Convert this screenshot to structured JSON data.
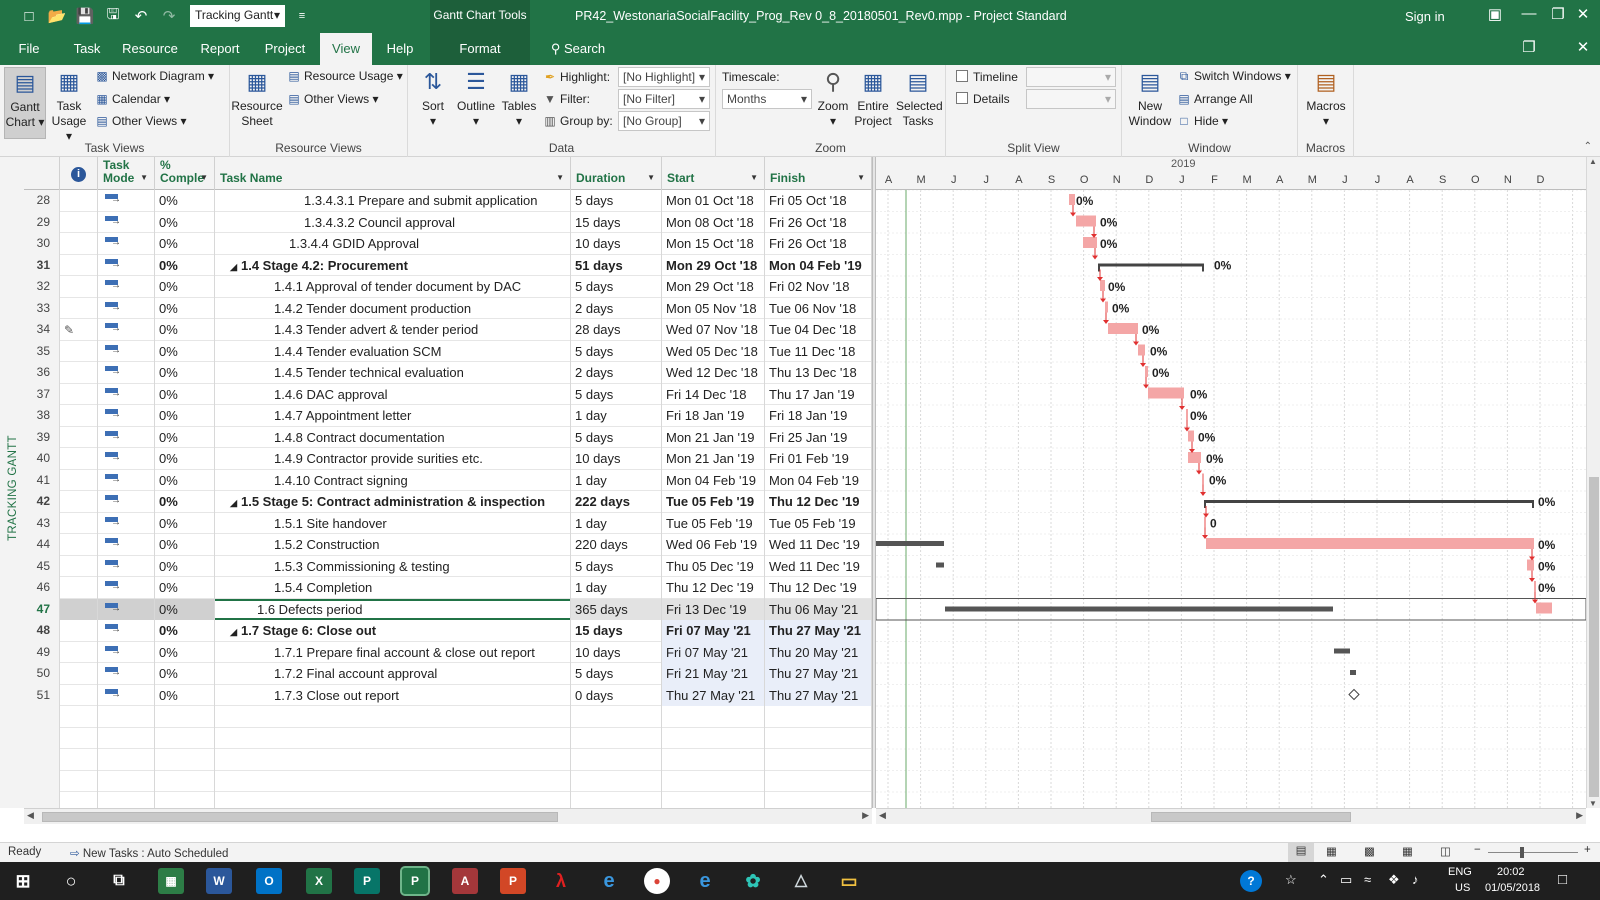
{
  "titlebar": {
    "view_selector": "Tracking Gantt",
    "context_tool": "Gantt Chart Tools",
    "document_title": "PR42_WestonariaSocialFacility_Prog_Rev 0_8_20180501_Rev0.mpp  -  Project Standard",
    "signin": "Sign in"
  },
  "tabs": [
    "File",
    "Task",
    "Resource",
    "Report",
    "Project",
    "View",
    "Help",
    "Format"
  ],
  "search_label": "Search",
  "ribbon": {
    "task_views": {
      "label": "Task Views",
      "gantt_chart": "Gantt Chart",
      "task_usage": "Task Usage",
      "network_diagram": "Network Diagram",
      "calendar": "Calendar",
      "other_views": "Other Views"
    },
    "resource_views": {
      "label": "Resource Views",
      "resource_sheet": "Resource Sheet",
      "resource_usage": "Resource Usage",
      "other_views": "Other Views"
    },
    "data": {
      "label": "Data",
      "sort": "Sort",
      "outline": "Outline",
      "tables": "Tables",
      "highlight_label": "Highlight:",
      "highlight_value": "[No Highlight]",
      "filter_label": "Filter:",
      "filter_value": "[No Filter]",
      "groupby_label": "Group by:",
      "groupby_value": "[No Group]"
    },
    "zoom": {
      "label": "Zoom",
      "timescale_label": "Timescale:",
      "timescale_value": "Months",
      "zoom": "Zoom",
      "entire_project": "Entire Project",
      "selected_tasks": "Selected Tasks"
    },
    "split_view": {
      "label": "Split View",
      "timeline": "Timeline",
      "details": "Details"
    },
    "window": {
      "label": "Window",
      "new_window": "New Window",
      "switch_windows": "Switch Windows",
      "arrange_all": "Arrange All",
      "hide": "Hide"
    },
    "macros": {
      "label": "Macros",
      "macros": "Macros"
    }
  },
  "side_label": "TRACKING GANTT",
  "columns": {
    "mode": "Task Mode",
    "pct": "% Comple",
    "name": "Task Name",
    "duration": "Duration",
    "start": "Start",
    "finish": "Finish"
  },
  "tasks": [
    {
      "id": "28",
      "pct": "0%",
      "name": "1.3.4.3.1 Prepare and submit application",
      "dur": "5 days",
      "start": "Mon 01 Oct '18",
      "fin": "Fri 05 Oct '18"
    },
    {
      "id": "29",
      "pct": "0%",
      "name": "1.3.4.3.2 Council approval",
      "dur": "15 days",
      "start": "Mon 08 Oct '18",
      "fin": "Fri 26 Oct '18"
    },
    {
      "id": "30",
      "pct": "0%",
      "name": "1.3.4.4 GDID Approval",
      "dur": "10 days",
      "start": "Mon 15 Oct '18",
      "fin": "Fri 26 Oct '18"
    },
    {
      "id": "31",
      "pct": "0%",
      "name": "1.4 Stage 4.2: Procurement",
      "dur": "51 days",
      "start": "Mon 29 Oct '18",
      "fin": "Mon 04 Feb '19"
    },
    {
      "id": "32",
      "pct": "0%",
      "name": "1.4.1 Approval of tender document by DAC",
      "dur": "5 days",
      "start": "Mon 29 Oct '18",
      "fin": "Fri 02 Nov '18"
    },
    {
      "id": "33",
      "pct": "0%",
      "name": "1.4.2 Tender document production",
      "dur": "2 days",
      "start": "Mon 05 Nov '18",
      "fin": "Tue 06 Nov '18"
    },
    {
      "id": "34",
      "pct": "0%",
      "name": "1.4.3 Tender advert & tender period",
      "dur": "28 days",
      "start": "Wed 07 Nov '18",
      "fin": "Tue 04 Dec '18"
    },
    {
      "id": "35",
      "pct": "0%",
      "name": "1.4.4 Tender evaluation SCM",
      "dur": "5 days",
      "start": "Wed 05 Dec '18",
      "fin": "Tue 11 Dec '18"
    },
    {
      "id": "36",
      "pct": "0%",
      "name": "1.4.5 Tender technical evaluation",
      "dur": "2 days",
      "start": "Wed 12 Dec '18",
      "fin": "Thu 13 Dec '18"
    },
    {
      "id": "37",
      "pct": "0%",
      "name": "1.4.6 DAC approval",
      "dur": "5 days",
      "start": "Fri 14 Dec '18",
      "fin": "Thu 17 Jan '19"
    },
    {
      "id": "38",
      "pct": "0%",
      "name": "1.4.7 Appointment letter",
      "dur": "1 day",
      "start": "Fri 18 Jan '19",
      "fin": "Fri 18 Jan '19"
    },
    {
      "id": "39",
      "pct": "0%",
      "name": "1.4.8 Contract documentation",
      "dur": "5 days",
      "start": "Mon 21 Jan '19",
      "fin": "Fri 25 Jan '19"
    },
    {
      "id": "40",
      "pct": "0%",
      "name": "1.4.9 Contractor provide surities etc.",
      "dur": "10 days",
      "start": "Mon 21 Jan '19",
      "fin": "Fri 01 Feb '19"
    },
    {
      "id": "41",
      "pct": "0%",
      "name": "1.4.10 Contract signing",
      "dur": "1 day",
      "start": "Mon 04 Feb '19",
      "fin": "Mon 04 Feb '19"
    },
    {
      "id": "42",
      "pct": "0%",
      "name": "1.5 Stage 5: Contract administration & inspection",
      "dur": "222 days",
      "start": "Tue 05 Feb '19",
      "fin": "Thu 12 Dec '19"
    },
    {
      "id": "43",
      "pct": "0%",
      "name": "1.5.1 Site handover",
      "dur": "1 day",
      "start": "Tue 05 Feb '19",
      "fin": "Tue 05 Feb '19"
    },
    {
      "id": "44",
      "pct": "0%",
      "name": "1.5.2 Construction",
      "dur": "220 days",
      "start": "Wed 06 Feb '19",
      "fin": "Wed 11 Dec '19"
    },
    {
      "id": "45",
      "pct": "0%",
      "name": "1.5.3 Commissioning & testing",
      "dur": "5 days",
      "start": "Thu 05 Dec '19",
      "fin": "Wed 11 Dec '19"
    },
    {
      "id": "46",
      "pct": "0%",
      "name": "1.5.4 Completion",
      "dur": "1 day",
      "start": "Thu 12 Dec '19",
      "fin": "Thu 12 Dec '19"
    },
    {
      "id": "47",
      "pct": "0%",
      "name": "1.6 Defects period",
      "dur": "365 days",
      "start": "Fri 13 Dec '19",
      "fin": "Thu 06 May '21"
    },
    {
      "id": "48",
      "pct": "0%",
      "name": "1.7 Stage 6: Close out",
      "dur": "15 days",
      "start": "Fri 07 May '21",
      "fin": "Thu 27 May '21"
    },
    {
      "id": "49",
      "pct": "0%",
      "name": "1.7.1 Prepare final account & close out report",
      "dur": "10 days",
      "start": "Fri 07 May '21",
      "fin": "Thu 20 May '21"
    },
    {
      "id": "50",
      "pct": "0%",
      "name": "1.7.2 Final account approval",
      "dur": "5 days",
      "start": "Fri 21 May '21",
      "fin": "Thu 27 May '21"
    },
    {
      "id": "51",
      "pct": "0%",
      "name": "1.7.3 Close out report",
      "dur": "0 days",
      "start": "Thu 27 May '21",
      "fin": "Thu 27 May '21"
    }
  ],
  "gantt": {
    "year_label": "2019",
    "months": [
      "A",
      "M",
      "J",
      "J",
      "A",
      "S",
      "O",
      "N",
      "D",
      "J",
      "F",
      "M",
      "A",
      "M",
      "J",
      "J",
      "A",
      "S",
      "O",
      "N",
      "D"
    ],
    "bar_labels": [
      "0%",
      "0%",
      "0%",
      "0%",
      "0%",
      "0%",
      "0%",
      "0%",
      "0%",
      "0%",
      "0%",
      "0%",
      "0%",
      "0%",
      "0%",
      "0",
      "0%",
      "0%",
      "0%",
      "0%"
    ]
  },
  "status": {
    "ready": "Ready",
    "new_tasks": "New Tasks : Auto Scheduled"
  },
  "tray": {
    "lang1": "ENG",
    "lang2": "US",
    "time": "20:02",
    "date": "01/05/2018"
  },
  "colors": {
    "accent": "#217346",
    "task_bar": "#f4a6a6",
    "critical_link": "#e03030",
    "summary": "#444444"
  }
}
